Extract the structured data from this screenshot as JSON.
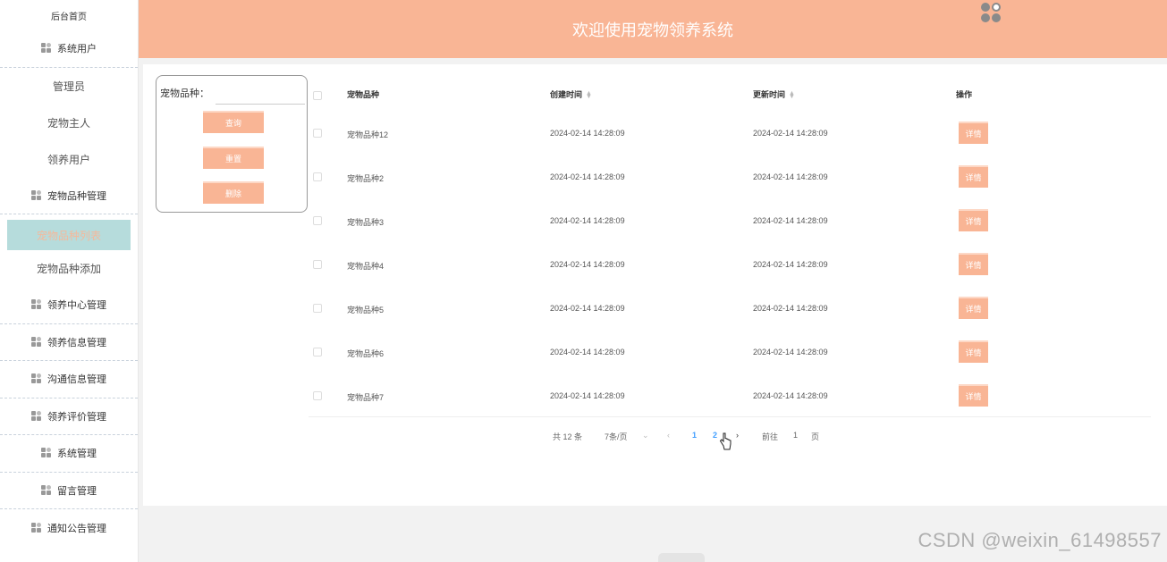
{
  "sidebar": {
    "top_link": "后台首页",
    "groups": [
      {
        "label": "系统用户",
        "items": [
          "管理员",
          "宠物主人",
          "领养用户"
        ]
      },
      {
        "label": "宠物品种管理",
        "items": [
          "宠物品种列表",
          "宠物品种添加"
        ],
        "active_item": "宠物品种列表"
      },
      {
        "label": "领养中心管理"
      },
      {
        "label": "领养信息管理"
      },
      {
        "label": "沟通信息管理"
      },
      {
        "label": "领养评价管理"
      },
      {
        "label": "系统管理"
      },
      {
        "label": "留言管理"
      },
      {
        "label": "通知公告管理"
      }
    ]
  },
  "header": {
    "title": "欢迎使用宠物领养系统",
    "avatar_icon": "user-avatar-icon"
  },
  "search": {
    "label": "宠物品种：",
    "value": "",
    "query_button": "查询",
    "reset_button": "重置",
    "delete_button": "删除"
  },
  "table": {
    "columns": [
      "宠物品种",
      "创建时间",
      "更新时间",
      "操作"
    ],
    "rows": [
      {
        "breed": "宠物品种12",
        "created": "2024-02-14 14:28:09",
        "updated": "2024-02-14 14:28:09",
        "action": "详情"
      },
      {
        "breed": "宠物品种2",
        "created": "2024-02-14 14:28:09",
        "updated": "2024-02-14 14:28:09",
        "action": "详情"
      },
      {
        "breed": "宠物品种3",
        "created": "2024-02-14 14:28:09",
        "updated": "2024-02-14 14:28:09",
        "action": "详情"
      },
      {
        "breed": "宠物品种4",
        "created": "2024-02-14 14:28:09",
        "updated": "2024-02-14 14:28:09",
        "action": "详情"
      },
      {
        "breed": "宠物品种5",
        "created": "2024-02-14 14:28:09",
        "updated": "2024-02-14 14:28:09",
        "action": "详情"
      },
      {
        "breed": "宠物品种6",
        "created": "2024-02-14 14:28:09",
        "updated": "2024-02-14 14:28:09",
        "action": "详情"
      },
      {
        "breed": "宠物品种7",
        "created": "2024-02-14 14:28:09",
        "updated": "2024-02-14 14:28:09",
        "action": "详情"
      }
    ]
  },
  "pagination": {
    "total": "共 12 条",
    "page_size": "7条/页",
    "pages": [
      "1",
      "2"
    ],
    "current_page": "1",
    "goto_label": "前往",
    "goto_value": "1",
    "unit": "页"
  },
  "watermark": "CSDN @weixin_61498557",
  "colors": {
    "accent": "#f9b595",
    "active_menu_bg": "#b6dcdc",
    "link": "#409eff"
  }
}
